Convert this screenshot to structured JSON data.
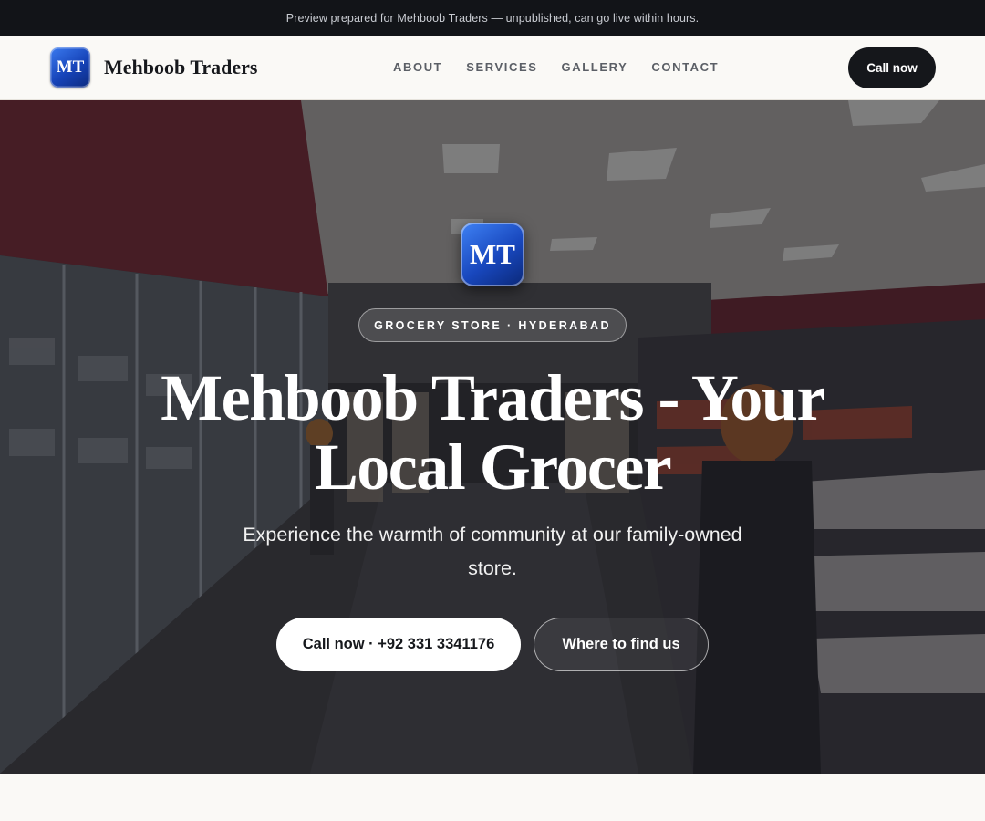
{
  "banner": {
    "text": "Preview prepared for Mehboob Traders — unpublished, can go live within hours."
  },
  "header": {
    "logo_initials": "MT",
    "brand_name": "Mehboob Traders",
    "nav": [
      {
        "label": "ABOUT"
      },
      {
        "label": "SERVICES"
      },
      {
        "label": "GALLERY"
      },
      {
        "label": "CONTACT"
      }
    ],
    "call_button": "Call now"
  },
  "hero": {
    "background_image": "grocery-store-aisle-photo",
    "logo_initials": "MT",
    "tag": "GROCERY STORE · HYDERABAD",
    "title": "Mehboob Traders - Your Local Grocer",
    "subtitle": "Experience the warmth of community at our family-owned store.",
    "primary_button": "Call now · +92 331 3341176",
    "secondary_button": "Where to find us"
  },
  "colors": {
    "banner_bg": "#121418",
    "header_bg": "#faf9f6",
    "brand_blue": "#1643b8",
    "dark_button": "#15171b",
    "store_red": "#7a1f2b"
  }
}
